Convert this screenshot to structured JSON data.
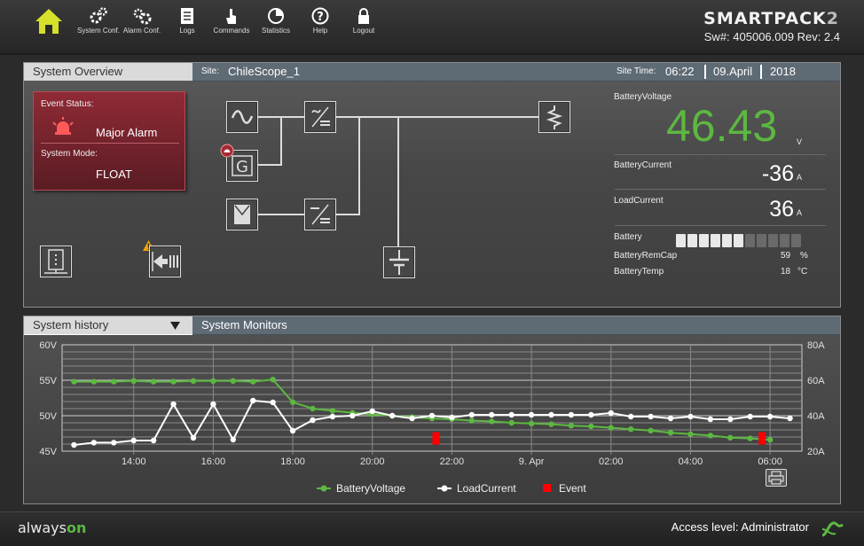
{
  "nav": [
    {
      "id": "home",
      "label": ""
    },
    {
      "id": "system",
      "label": "System Conf."
    },
    {
      "id": "alarm",
      "label": "Alarm Conf."
    },
    {
      "id": "logs",
      "label": "Logs"
    },
    {
      "id": "commands",
      "label": "Commands"
    },
    {
      "id": "statistics",
      "label": "Statistics"
    },
    {
      "id": "help",
      "label": "Help"
    },
    {
      "id": "logout",
      "label": "Logout"
    }
  ],
  "brand": {
    "part1": "SMARTPACK",
    "part2": "2"
  },
  "sw_info": "Sw#: 405006.009 Rev: 2.4",
  "overview": {
    "title": "System Overview",
    "site_label": "Site:",
    "site_name": "ChileScope_1",
    "site_time_label": "Site Time:",
    "time": "06:22",
    "date": "09.April",
    "year": "2018",
    "event_status_label": "Event Status:",
    "event_status": "Major Alarm",
    "system_mode_label": "System Mode:",
    "system_mode": "FLOAT",
    "battery_voltage_label": "BatteryVoltage",
    "battery_voltage": "46.43",
    "battery_voltage_unit": "V",
    "battery_current_label": "BatteryCurrent",
    "battery_current": "-36",
    "battery_current_unit": "A",
    "load_current_label": "LoadCurrent",
    "load_current": "36",
    "load_current_unit": "A",
    "battery_label": "Battery",
    "battery_segments_total": 11,
    "battery_segments_lit": 6,
    "battery_remcap_label": "BatteryRemCap",
    "battery_remcap": "59",
    "battery_remcap_unit": "%",
    "battery_temp_label": "BatteryTemp",
    "battery_temp": "18",
    "battery_temp_unit": "°C"
  },
  "history": {
    "dropdown": "System history",
    "title": "System Monitors"
  },
  "chart_data": {
    "type": "line",
    "x_ticks": [
      "14:00",
      "16:00",
      "18:00",
      "20:00",
      "22:00",
      "9. Apr",
      "02:00",
      "04:00",
      "06:00"
    ],
    "y_left_ticks": [
      "60V",
      "55V",
      "50V",
      "45V"
    ],
    "y_right_ticks": [
      "80A",
      "60A",
      "40A",
      "20A"
    ],
    "ylim_left": [
      45,
      60
    ],
    "ylim_right": [
      20,
      80
    ],
    "grid": true,
    "legend_position": "bottom",
    "series": [
      {
        "name": "BatteryVoltage",
        "axis": "left",
        "color": "#5cb840",
        "points": [
          [
            12.5,
            54.8
          ],
          [
            13.0,
            54.8
          ],
          [
            13.5,
            54.8
          ],
          [
            14.0,
            54.9
          ],
          [
            14.5,
            54.8
          ],
          [
            15.0,
            54.8
          ],
          [
            15.5,
            54.9
          ],
          [
            16.0,
            54.9
          ],
          [
            16.5,
            54.9
          ],
          [
            17.0,
            54.8
          ],
          [
            17.5,
            55.1
          ],
          [
            18.0,
            51.9
          ],
          [
            18.5,
            51.0
          ],
          [
            19.0,
            50.7
          ],
          [
            19.5,
            50.4
          ],
          [
            20.0,
            50.2
          ],
          [
            20.5,
            50.0
          ],
          [
            21.0,
            49.8
          ],
          [
            21.5,
            49.6
          ],
          [
            22.0,
            49.5
          ],
          [
            22.5,
            49.3
          ],
          [
            23.0,
            49.2
          ],
          [
            23.5,
            49.0
          ],
          [
            24.0,
            48.9
          ],
          [
            24.5,
            48.8
          ],
          [
            25.0,
            48.6
          ],
          [
            25.5,
            48.5
          ],
          [
            26.0,
            48.3
          ],
          [
            26.5,
            48.1
          ],
          [
            27.0,
            47.9
          ],
          [
            27.5,
            47.6
          ],
          [
            28.0,
            47.4
          ],
          [
            28.5,
            47.2
          ],
          [
            29.0,
            46.9
          ],
          [
            29.5,
            46.8
          ],
          [
            30.0,
            46.6
          ]
        ]
      },
      {
        "name": "LoadCurrent",
        "axis": "right",
        "color": "#ffffff",
        "points": [
          [
            12.5,
            23.5
          ],
          [
            13.0,
            24.8
          ],
          [
            13.5,
            24.8
          ],
          [
            14.0,
            26.0
          ],
          [
            14.5,
            26.0
          ],
          [
            15.0,
            46.5
          ],
          [
            15.5,
            27.5
          ],
          [
            16.0,
            46.5
          ],
          [
            16.5,
            26.5
          ],
          [
            17.0,
            48.5
          ],
          [
            17.5,
            47.5
          ],
          [
            18.0,
            31.5
          ],
          [
            18.5,
            37.5
          ],
          [
            19.0,
            39.5
          ],
          [
            19.5,
            40.0
          ],
          [
            20.0,
            42.5
          ],
          [
            20.5,
            40.0
          ],
          [
            21.0,
            38.5
          ],
          [
            21.5,
            40.0
          ],
          [
            22.0,
            39.0
          ],
          [
            22.5,
            40.5
          ],
          [
            23.0,
            40.5
          ],
          [
            23.5,
            40.5
          ],
          [
            24.0,
            40.5
          ],
          [
            24.5,
            40.5
          ],
          [
            25.0,
            40.5
          ],
          [
            25.5,
            40.5
          ],
          [
            26.0,
            41.5
          ],
          [
            26.5,
            39.5
          ],
          [
            27.0,
            39.5
          ],
          [
            27.5,
            38.5
          ],
          [
            28.0,
            39.5
          ],
          [
            28.5,
            38.0
          ],
          [
            29.0,
            38.0
          ],
          [
            29.5,
            39.5
          ],
          [
            30.0,
            39.5
          ],
          [
            30.5,
            38.5
          ]
        ]
      },
      {
        "name": "Event",
        "color": "#ff0000",
        "points": [
          [
            21.6,
            46.8
          ],
          [
            29.8,
            46.8
          ]
        ]
      }
    ]
  },
  "footer": {
    "logo_left": "always",
    "logo_right": "on",
    "access_level": "Access level: Administrator"
  },
  "colors": {
    "accent_green": "#5cb840",
    "alarm_red": "#8f2a35",
    "tab_blue": "#5e6a74",
    "warning": "#f0a400"
  }
}
